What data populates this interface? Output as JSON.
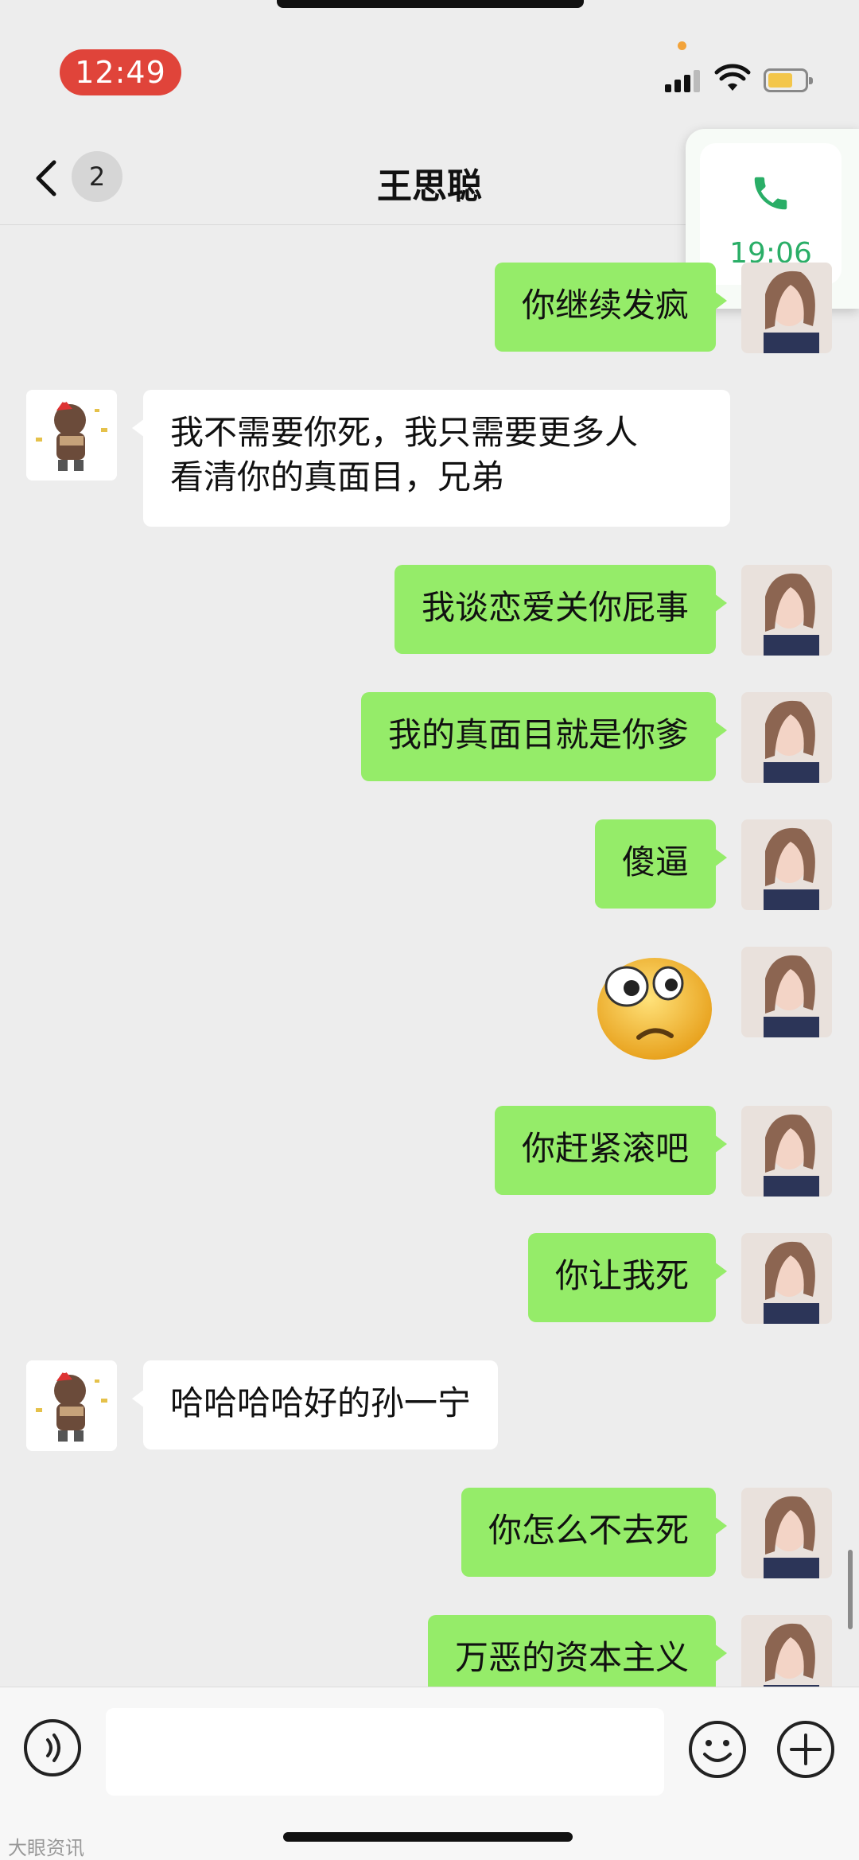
{
  "status_bar": {
    "time": "12:49"
  },
  "nav": {
    "unread_count": "2",
    "title": "王思聪"
  },
  "call_float": {
    "duration": "19:06",
    "accent": "#2aae67"
  },
  "messages": [
    {
      "from": "me",
      "text": "你继续发疯"
    },
    {
      "from": "them",
      "text": "我不需要你死，我只需要更多人\n看清你的真面目，兄弟"
    },
    {
      "from": "me",
      "text": "我谈恋爱关你屁事"
    },
    {
      "from": "me",
      "text": "我的真面目就是你爹"
    },
    {
      "from": "me",
      "text": "傻逼"
    },
    {
      "from": "me",
      "type": "sticker",
      "icon": "worried-face-sticker"
    },
    {
      "from": "me",
      "text": "你赶紧滚吧"
    },
    {
      "from": "me",
      "text": "你让我死"
    },
    {
      "from": "them",
      "text": "哈哈哈哈好的孙一宁"
    },
    {
      "from": "me",
      "text": "你怎么不去死"
    },
    {
      "from": "me",
      "text": "万恶的资本主义"
    }
  ],
  "input": {
    "placeholder": ""
  },
  "watermark": "大眼资讯",
  "colors": {
    "my_bubble": "#95ec69",
    "their_bubble": "#ffffff",
    "background": "#ededed",
    "time_pill": "#e0443a"
  }
}
